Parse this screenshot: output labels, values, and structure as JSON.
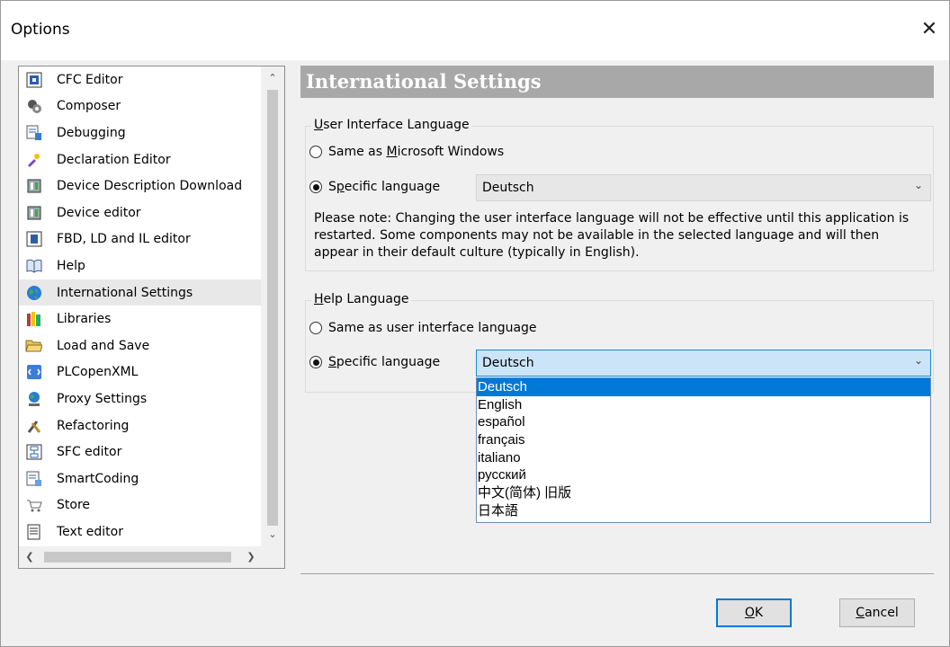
{
  "window": {
    "title": "Options",
    "close_glyph": "✕"
  },
  "sidebar": {
    "items": [
      {
        "label": "CFC Editor",
        "icon": "cfc-editor-icon"
      },
      {
        "label": "Composer",
        "icon": "composer-icon"
      },
      {
        "label": "Debugging",
        "icon": "debugging-icon"
      },
      {
        "label": "Declaration Editor",
        "icon": "declaration-editor-icon"
      },
      {
        "label": "Device Description Download",
        "icon": "device-description-icon"
      },
      {
        "label": "Device editor",
        "icon": "device-editor-icon"
      },
      {
        "label": "FBD, LD and IL editor",
        "icon": "fbd-editor-icon"
      },
      {
        "label": "Help",
        "icon": "help-book-icon"
      },
      {
        "label": "International Settings",
        "icon": "globe-icon",
        "selected": true
      },
      {
        "label": "Libraries",
        "icon": "libraries-icon"
      },
      {
        "label": "Load and Save",
        "icon": "folder-open-icon"
      },
      {
        "label": "PLCopenXML",
        "icon": "plcopenxml-icon"
      },
      {
        "label": "Proxy Settings",
        "icon": "proxy-network-icon"
      },
      {
        "label": "Refactoring",
        "icon": "refactoring-tools-icon"
      },
      {
        "label": "SFC editor",
        "icon": "sfc-editor-icon"
      },
      {
        "label": "SmartCoding",
        "icon": "smartcoding-icon"
      },
      {
        "label": "Store",
        "icon": "store-cart-icon"
      },
      {
        "label": "Text editor",
        "icon": "text-editor-icon"
      }
    ]
  },
  "panel": {
    "title": "International Settings",
    "ui_language": {
      "legend_u": "U",
      "legend_rest": "ser Interface Language",
      "option1_pre": "Same as ",
      "option1_u": "M",
      "option1_post": "icrosoft Windows",
      "option2_pre": "S",
      "option2_u": "p",
      "option2_post": "ecific language",
      "selected_value": "Deutsch",
      "note": "Please note: Changing the user interface language will not be effective until this application is restarted. Some components may not be available in the selected language and will then appear in their default culture (typically in English)."
    },
    "help_language": {
      "legend_u": "H",
      "legend_rest": "elp Language",
      "option1": "Same as user interface language",
      "option2_pre": "",
      "option2_u": "S",
      "option2_post": "pecific language",
      "selected_value": "Deutsch",
      "options": [
        "Deutsch",
        "English",
        "español",
        "français",
        "italiano",
        "русский",
        "中文(简体) 旧版",
        "日本語"
      ]
    }
  },
  "buttons": {
    "ok_u": "O",
    "ok_rest": "K",
    "cancel_u": "C",
    "cancel_rest": "ancel"
  }
}
